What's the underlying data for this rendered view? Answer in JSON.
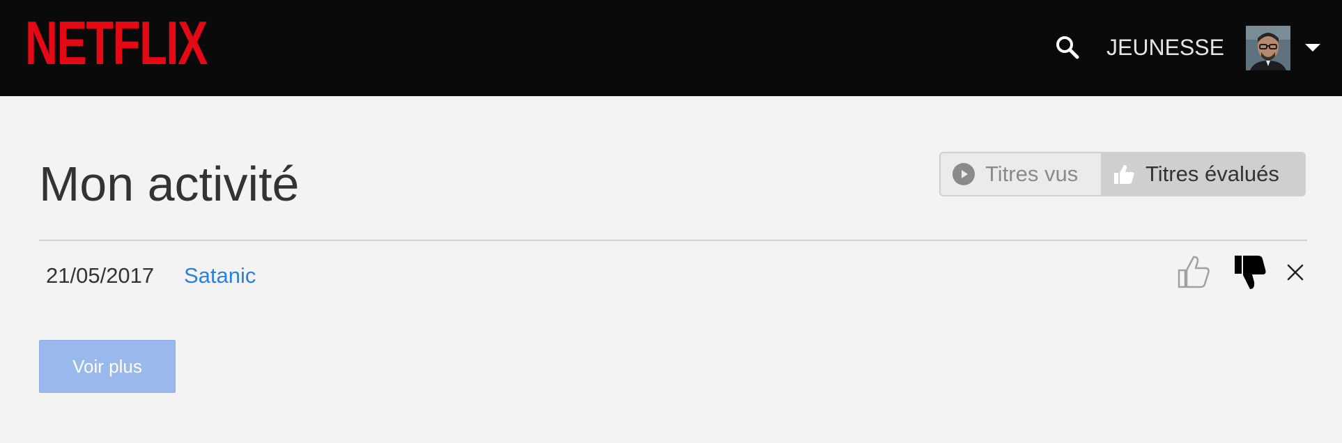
{
  "header": {
    "logo_text": "NETFLIX",
    "search_icon": "search-icon",
    "profile_name": "JEUNESSE",
    "avatar_icon": "avatar",
    "dropdown_icon": "caret-down-icon"
  },
  "page": {
    "title": "Mon activité"
  },
  "toggle": {
    "viewed_label": "Titres vus",
    "rated_label": "Titres évalués",
    "selected": "rated"
  },
  "activity": {
    "rows": [
      {
        "date": "21/05/2017",
        "title": "Satanic",
        "rating": "thumbs-down"
      }
    ]
  },
  "actions": {
    "more_label": "Voir plus"
  },
  "colors": {
    "brand": "#e50914",
    "link": "#2f7fd9",
    "button": "#99b9ec",
    "header_bg": "#0a0a0a",
    "page_bg": "#f3f3f3"
  }
}
